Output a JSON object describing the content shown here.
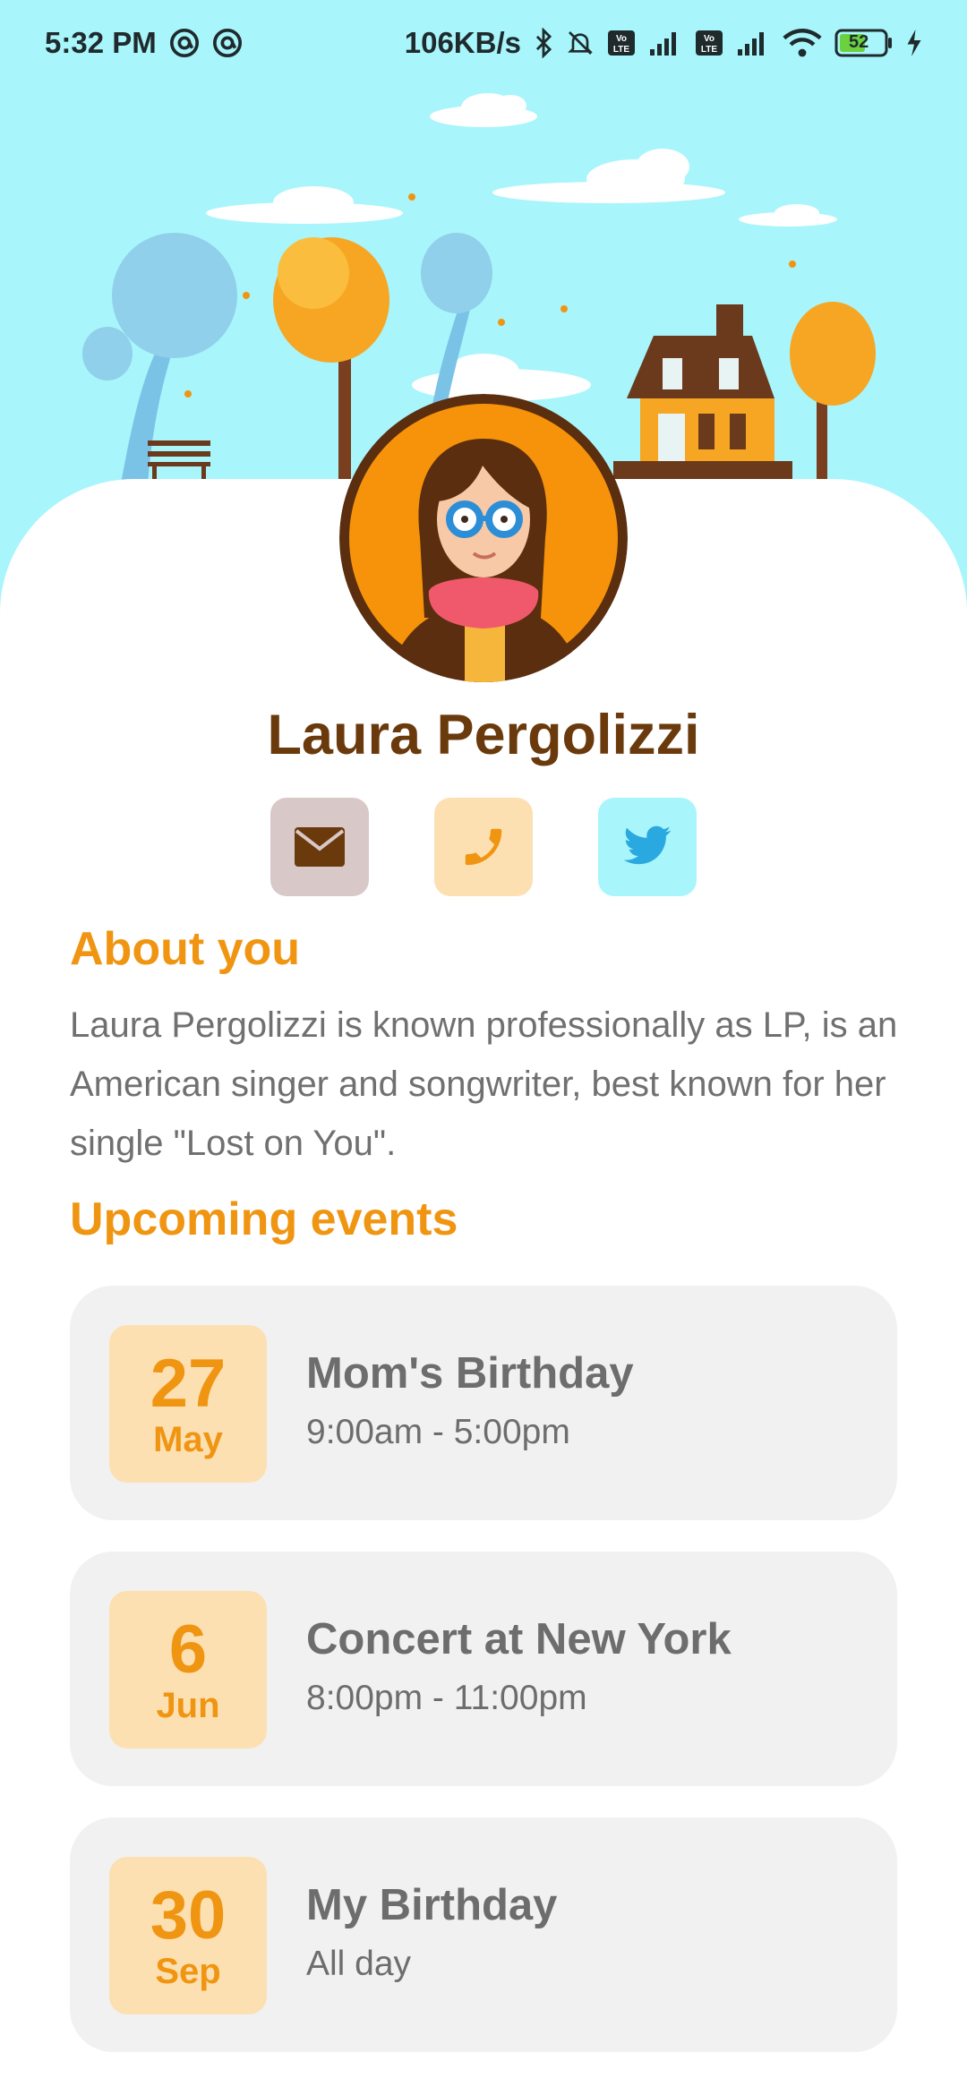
{
  "status_bar": {
    "time": "5:32 PM",
    "speed": "106KB/s",
    "battery": "52",
    "left_icons": [
      "at-sign-icon",
      "at-sign-icon"
    ],
    "right_icons": [
      "bluetooth-icon",
      "bell-off-icon",
      "volte-icon",
      "signal-icon",
      "volte-icon",
      "signal-icon",
      "wifi-icon",
      "battery-icon",
      "charging-icon"
    ]
  },
  "profile": {
    "name": "Laura Pergolizzi",
    "contacts": [
      {
        "icon": "mail-icon",
        "bg": "#d9c8c8",
        "color": "#6b3a0c"
      },
      {
        "icon": "phone-icon",
        "bg": "#fde0b1",
        "color": "#f09512"
      },
      {
        "icon": "twitter-icon",
        "bg": "#a8f5fb",
        "color": "#2aa9e0"
      }
    ]
  },
  "about": {
    "title": "About you",
    "text": "Laura Pergolizzi is known professionally as LP, is an American singer and songwriter, best known for her single \"Lost on You\"."
  },
  "events": {
    "title": "Upcoming events",
    "items": [
      {
        "day": "27",
        "month": "May",
        "title": "Mom's Birthday",
        "time": "9:00am - 5:00pm"
      },
      {
        "day": "6",
        "month": "Jun",
        "title": "Concert at New York",
        "time": "8:00pm - 11:00pm"
      },
      {
        "day": "30",
        "month": "Sep",
        "title": "My Birthday",
        "time": "All day"
      }
    ]
  },
  "colors": {
    "sky": "#a8f5fb",
    "accent": "#f09512",
    "name": "#6b3a0c",
    "card": "#f1f1f1",
    "date_bg": "#fde0b1"
  }
}
